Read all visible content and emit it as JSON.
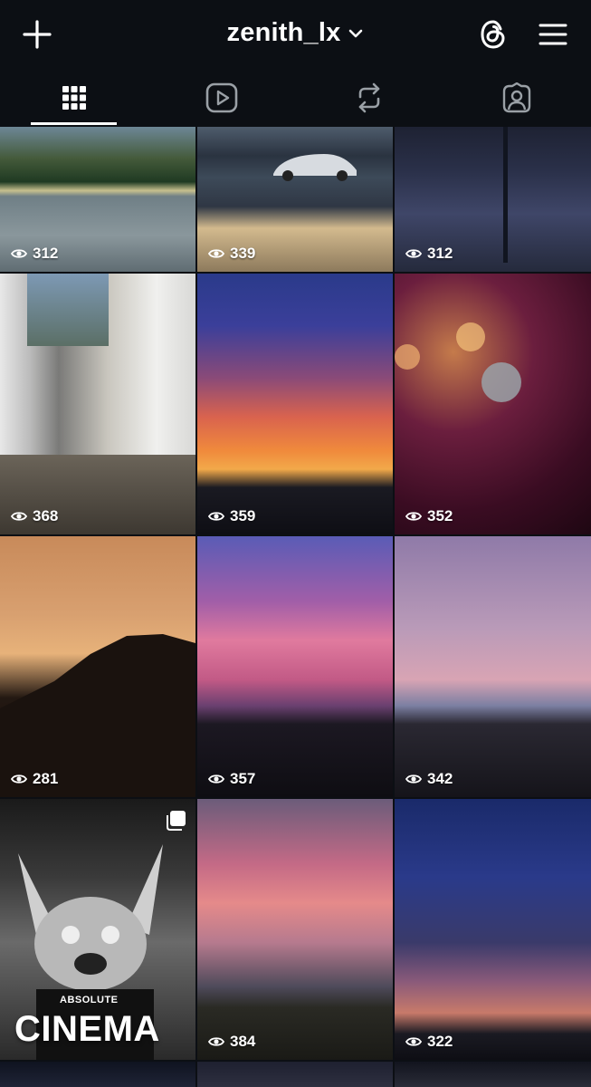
{
  "header": {
    "username": "zenith_lx",
    "icons": {
      "left": "plus-icon",
      "threads": "threads-icon",
      "menu": "hamburger-menu-icon"
    }
  },
  "tabs": [
    {
      "name": "grid-tab",
      "icon": "grid-icon",
      "active": true
    },
    {
      "name": "reels-tab",
      "icon": "reels-play-icon",
      "active": false
    },
    {
      "name": "reposts-tab",
      "icon": "repost-icon",
      "active": false
    },
    {
      "name": "tagged-tab",
      "icon": "tagged-person-icon",
      "active": false
    }
  ],
  "posts": [
    {
      "views": "312",
      "subject": "lake-landscape"
    },
    {
      "views": "339",
      "subject": "sports-car"
    },
    {
      "views": "312",
      "subject": "night-lake-tree"
    },
    {
      "views": "368",
      "subject": "village-street"
    },
    {
      "views": "359",
      "subject": "sunset-clouds"
    },
    {
      "views": "352",
      "subject": "water-drop-flower"
    },
    {
      "views": "281",
      "subject": "mountain-silhouette"
    },
    {
      "views": "357",
      "subject": "pink-swirl-sky"
    },
    {
      "views": "342",
      "subject": "dusk-hills"
    },
    {
      "views": "",
      "subject": "fox-mascot",
      "overlay_small": "ABSOLUTE",
      "overlay_big": "CINEMA",
      "multiple": true
    },
    {
      "views": "384",
      "subject": "pink-clouds-field"
    },
    {
      "views": "322",
      "subject": "blue-sky-clouds"
    }
  ],
  "colors": {
    "background": "#0c0f14",
    "text": "#ffffff"
  }
}
